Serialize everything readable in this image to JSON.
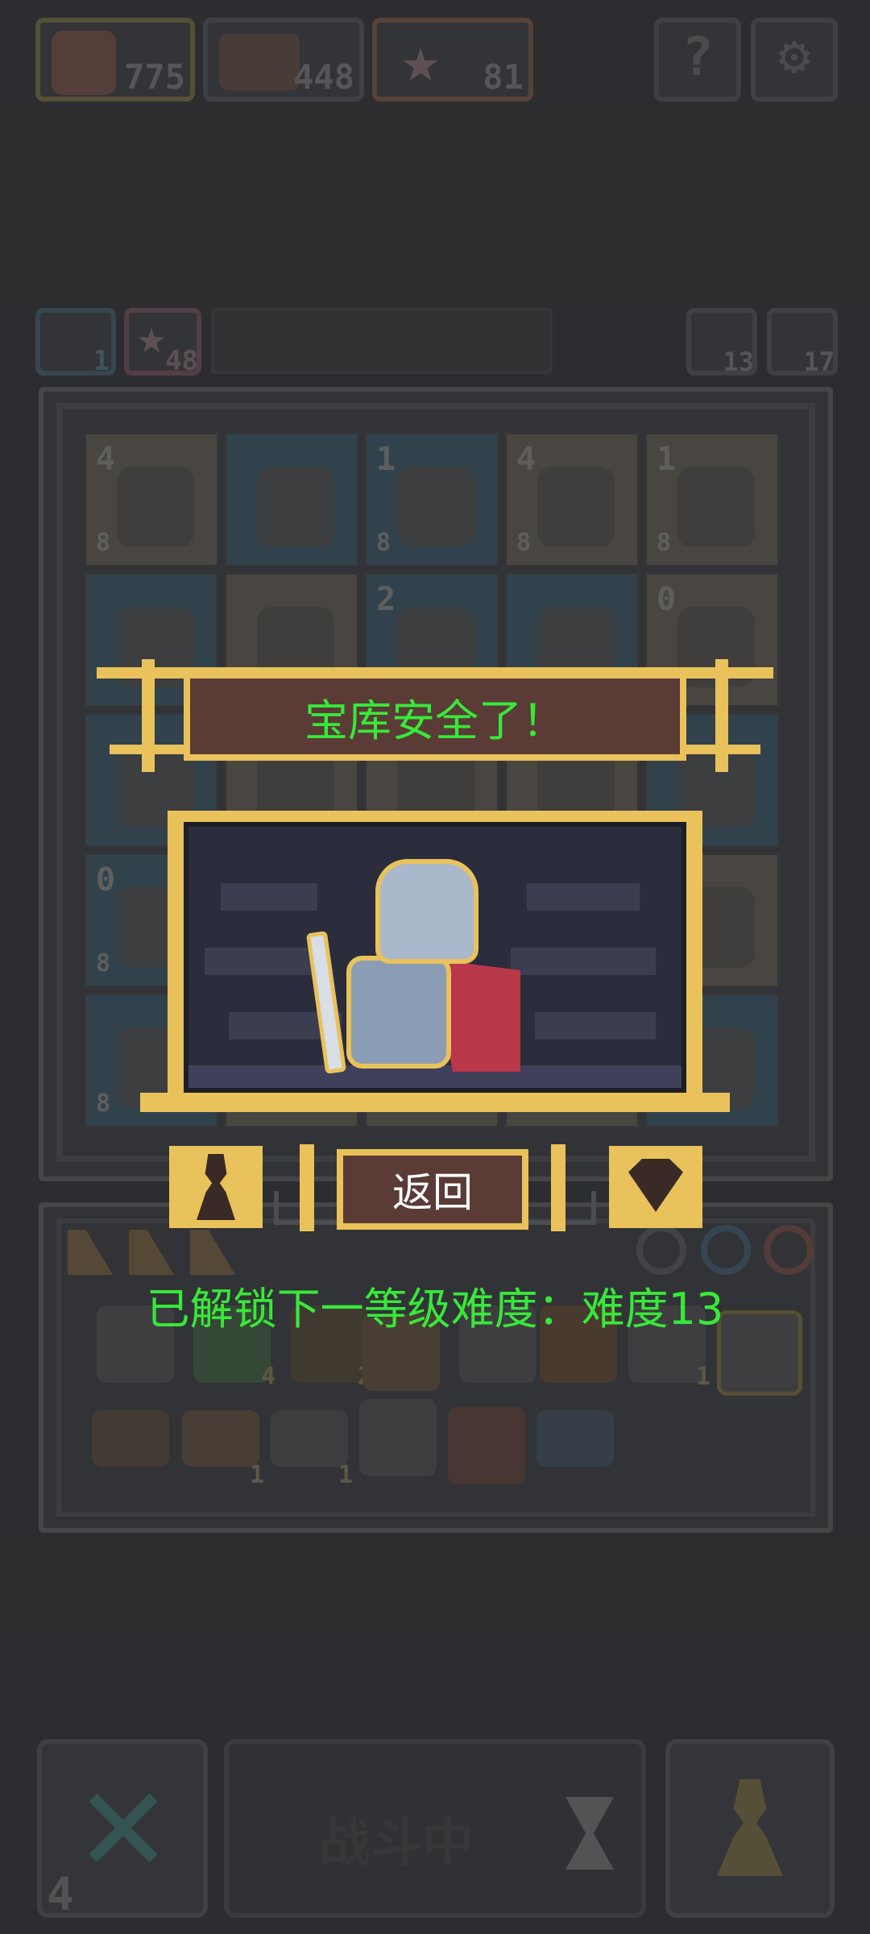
{
  "top_bar": {
    "resources": [
      {
        "name": "heroes",
        "count": "775",
        "icon": "hero-portrait-icon"
      },
      {
        "name": "chest",
        "count": "448",
        "icon": "treasure-chest-icon"
      },
      {
        "name": "stars",
        "count": "81",
        "icon": "star-icon"
      }
    ],
    "help_icon": "question-icon",
    "settings_icon": "gear-icon"
  },
  "sub_bar": {
    "left_counts": [
      "1",
      "48"
    ],
    "right_counts": [
      "13",
      "17"
    ]
  },
  "board": {
    "rows": [
      [
        {
          "lvl": "4",
          "sub": "8",
          "bg": "tan"
        },
        {
          "lvl": "",
          "sub": "",
          "bg": "blue"
        },
        {
          "lvl": "1",
          "sub": "8",
          "bg": "blue"
        },
        {
          "lvl": "4",
          "sub": "8",
          "bg": "tan"
        },
        {
          "lvl": "1",
          "sub": "8",
          "bg": "tan"
        }
      ],
      [
        {
          "lvl": "",
          "sub": "",
          "bg": "blue"
        },
        {
          "lvl": "",
          "sub": "",
          "bg": "tan"
        },
        {
          "lvl": "2",
          "sub": "",
          "bg": "blue"
        },
        {
          "lvl": "",
          "sub": "",
          "bg": "blue"
        },
        {
          "lvl": "0",
          "sub": "",
          "bg": "tan"
        }
      ],
      [
        {
          "lvl": "",
          "sub": "",
          "bg": "blue"
        },
        {
          "lvl": "",
          "sub": "",
          "bg": "tan"
        },
        {
          "lvl": "",
          "sub": "",
          "bg": "tan"
        },
        {
          "lvl": "",
          "sub": "",
          "bg": "tan"
        },
        {
          "lvl": "",
          "sub": "",
          "bg": "blue"
        }
      ],
      [
        {
          "lvl": "0",
          "sub": "8",
          "bg": "blue"
        },
        {
          "lvl": "",
          "sub": "",
          "bg": "tan"
        },
        {
          "lvl": "",
          "sub": "",
          "bg": "tan"
        },
        {
          "lvl": "",
          "sub": "",
          "bg": "tan"
        },
        {
          "lvl": "",
          "sub": "",
          "bg": "tan"
        }
      ],
      [
        {
          "lvl": "",
          "sub": "8",
          "bg": "blue"
        },
        {
          "lvl": "",
          "sub": "",
          "bg": "tan"
        },
        {
          "lvl": "",
          "sub": "",
          "bg": "tan"
        },
        {
          "lvl": "",
          "sub": "",
          "bg": "tan"
        },
        {
          "lvl": "",
          "sub": "",
          "bg": "blue"
        }
      ]
    ]
  },
  "popup": {
    "title": "宝库安全了！",
    "back_label": "返回",
    "left_icon": "pawn-icon",
    "right_icon": "gem-icon"
  },
  "unlock_message": "已解锁下一等级难度：难度13",
  "inventory": {
    "row2_badges": [
      "4",
      "2",
      "",
      "",
      "1"
    ],
    "row3_badges": [
      "",
      "1",
      "1",
      "",
      "",
      ""
    ]
  },
  "bottom_bar": {
    "battle_label": "战斗中",
    "left_count": "4",
    "cancel_icon": "cross-icon",
    "hourglass_icon": "hourglass-icon",
    "pawn_icon": "pawn-icon"
  },
  "colors": {
    "message_green": "#38e83a",
    "gold": "#e9c25b",
    "panel_brown": "#5a3b35",
    "background": "#2f3033"
  }
}
